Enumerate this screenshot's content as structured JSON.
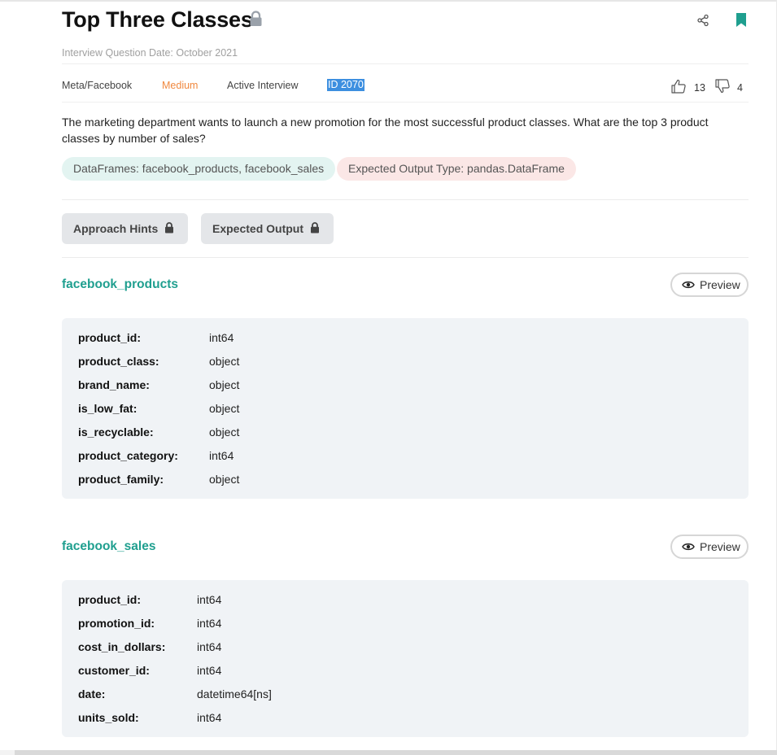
{
  "question": {
    "title": "Top Three Classes",
    "date_line": "Interview Question Date: October 2021",
    "company": "Meta/Facebook",
    "difficulty": "Medium",
    "status": "Active Interview",
    "id_label": "ID 2070",
    "upvotes": "13",
    "downvotes": "4",
    "description": "The marketing department wants to launch a new promotion for the most successful product classes. What are the top 3 product classes by number of sales?",
    "tags": {
      "dataframes": "DataFrames: facebook_products, facebook_sales",
      "output_type": "Expected Output Type: pandas.DataFrame"
    }
  },
  "buttons": {
    "approach_hints": "Approach Hints",
    "expected_output": "Expected Output",
    "preview": "Preview"
  },
  "tables": [
    {
      "name": "facebook_products",
      "columns": [
        {
          "name": "product_id:",
          "type": "int64"
        },
        {
          "name": "product_class:",
          "type": "object"
        },
        {
          "name": "brand_name:",
          "type": "object"
        },
        {
          "name": "is_low_fat:",
          "type": "object"
        },
        {
          "name": "is_recyclable:",
          "type": "object"
        },
        {
          "name": "product_category:",
          "type": "int64"
        },
        {
          "name": "product_family:",
          "type": "object"
        }
      ]
    },
    {
      "name": "facebook_sales",
      "columns": [
        {
          "name": "product_id:",
          "type": "int64"
        },
        {
          "name": "promotion_id:",
          "type": "int64"
        },
        {
          "name": "cost_in_dollars:",
          "type": "int64"
        },
        {
          "name": "customer_id:",
          "type": "int64"
        },
        {
          "name": "date:",
          "type": "datetime64[ns]"
        },
        {
          "name": "units_sold:",
          "type": "int64"
        }
      ]
    }
  ],
  "icons": {
    "title_lock": "lock-icon",
    "share": "share-icon",
    "bookmark": "bookmark-icon",
    "thumbs_up": "thumbs-up-icon",
    "thumbs_down": "thumbs-down-icon",
    "eye": "eye-icon"
  },
  "colors": {
    "accent": "#1f9f8f",
    "difficulty": "#f0883e",
    "id_highlight": "#3d8fe0",
    "tag_df_bg": "#e3f4f1",
    "tag_output_bg": "#fbe7e6"
  }
}
